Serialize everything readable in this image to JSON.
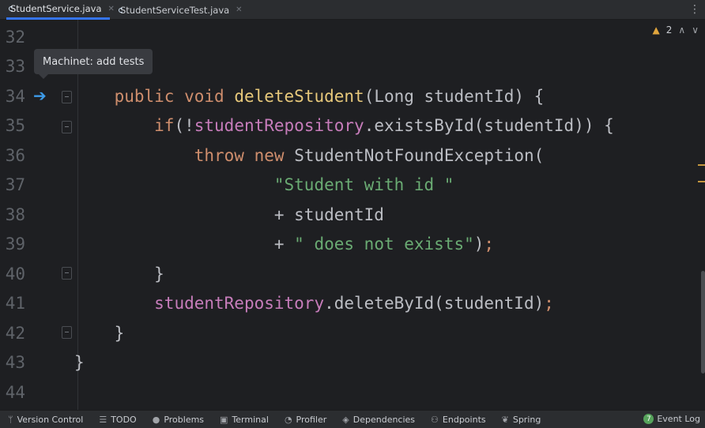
{
  "tabs": [
    {
      "label": "StudentService.java",
      "active": true
    },
    {
      "label": "StudentServiceTest.java",
      "active": false
    }
  ],
  "inspections": {
    "warning_count": "2"
  },
  "tooltip": "Machinet: add tests",
  "line_numbers": [
    "32",
    "33",
    "34",
    "35",
    "36",
    "37",
    "38",
    "39",
    "40",
    "41",
    "42",
    "43",
    "44"
  ],
  "code": {
    "l34": {
      "indent": "    ",
      "kw1": "public",
      "kw2": "void",
      "method": "deleteStudent",
      "rest": "(Long studentId) {"
    },
    "l35": {
      "indent": "        ",
      "kw": "if",
      "open": "(!",
      "field": "studentRepository",
      "call": ".existsById(studentId)) {"
    },
    "l36": {
      "indent": "            ",
      "kw1": "throw",
      "kw2": "new",
      "cls": "StudentNotFoundException("
    },
    "l37": {
      "indent": "                    ",
      "str": "\"Student with id \""
    },
    "l38": {
      "indent": "                    ",
      "text": "+ studentId"
    },
    "l39": {
      "indent": "                    ",
      "plus": "+ ",
      "str": "\" does not exists\"",
      "close": ")",
      "semi": ";"
    },
    "l40": {
      "indent": "        ",
      "text": "}"
    },
    "l41": {
      "indent": "        ",
      "field": "studentRepository",
      "call": ".deleteById(studentId)",
      "semi": ";"
    },
    "l42": {
      "indent": "    ",
      "text": "}"
    },
    "l43": {
      "indent": "",
      "text": "}"
    }
  },
  "toolwindows": [
    {
      "label": "Version Control",
      "icon": "branch-icon"
    },
    {
      "label": "TODO",
      "icon": "list-icon"
    },
    {
      "label": "Problems",
      "icon": "problems-icon"
    },
    {
      "label": "Terminal",
      "icon": "terminal-icon"
    },
    {
      "label": "Profiler",
      "icon": "profiler-icon"
    },
    {
      "label": "Dependencies",
      "icon": "dependencies-icon"
    },
    {
      "label": "Endpoints",
      "icon": "endpoints-icon"
    },
    {
      "label": "Spring",
      "icon": "spring-icon"
    }
  ],
  "event_log": {
    "count": "7",
    "label": "Event Log"
  },
  "colors": {
    "accent": "#3574f0",
    "keyword": "#cf8e6d",
    "string": "#6aab73",
    "field": "#c77dbb",
    "method_decl": "#e8c97b"
  }
}
